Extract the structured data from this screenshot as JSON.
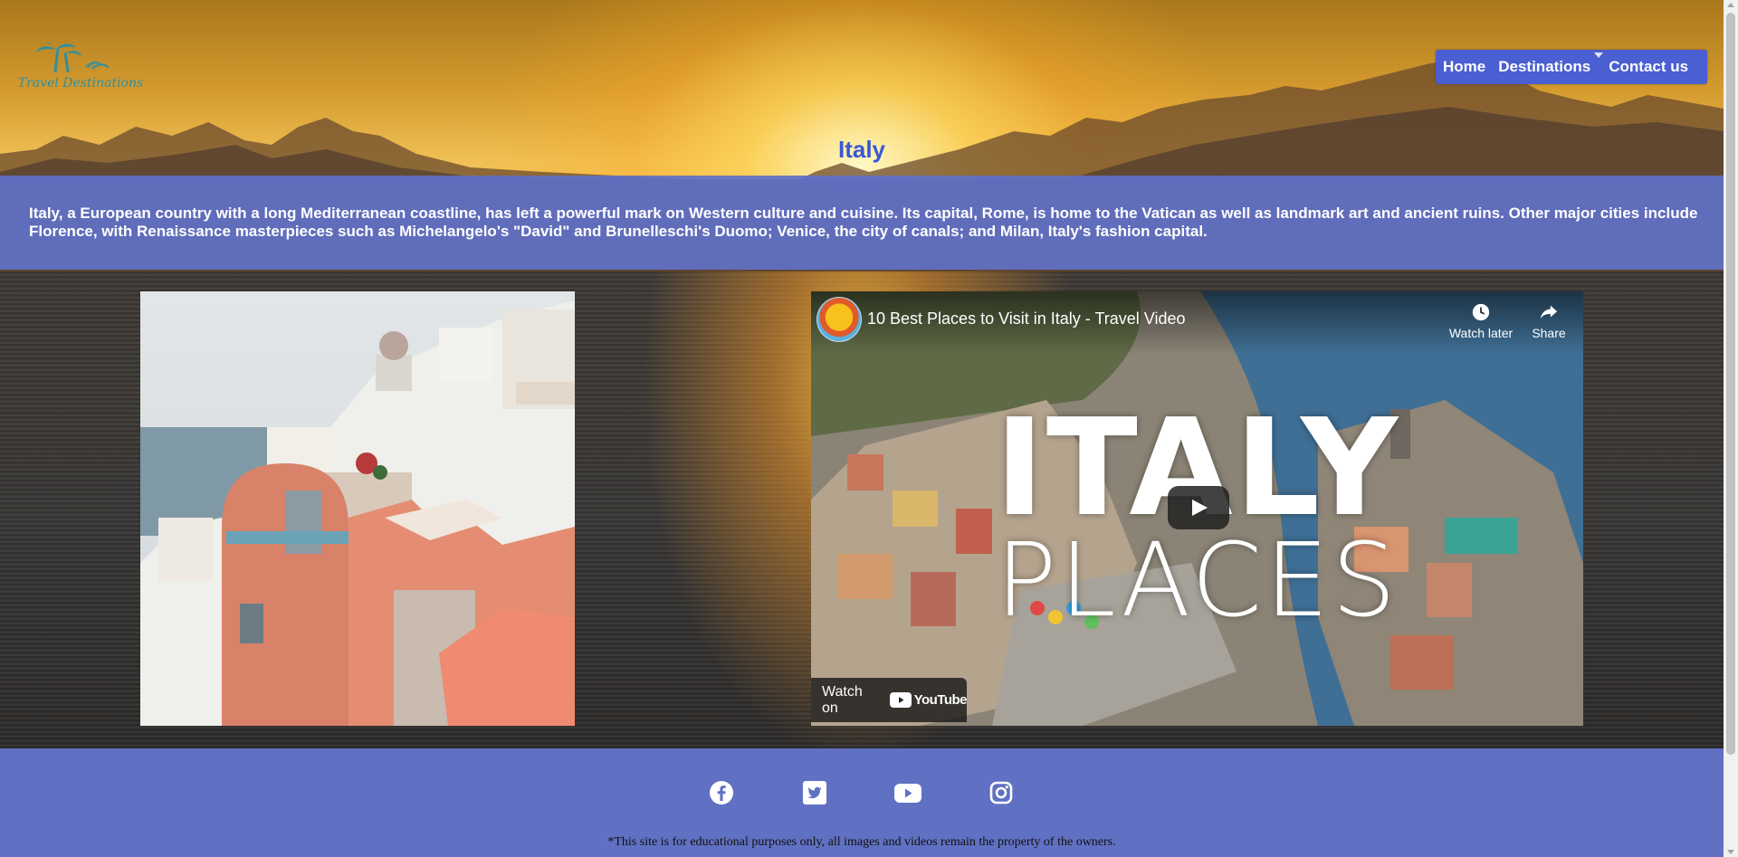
{
  "brand": {
    "logo_text": "Travel Destinations"
  },
  "nav": {
    "items": [
      {
        "label": "Home"
      },
      {
        "label": "Destinations"
      },
      {
        "label": "Contact us"
      }
    ]
  },
  "page": {
    "title": "Italy",
    "description": "Italy, a European country with a long Mediterranean coastline, has left a powerful mark on Western culture and cuisine. Its capital, Rome, is home to the Vatican as well as landmark art and ancient ruins. Other major cities include Florence, with Renaissance masterpieces such as Michelangelo's \"David\" and Brunelleschi's Duomo; Venice, the city of canals; and Milan, Italy's fashion capital."
  },
  "video": {
    "title": "10 Best Places to Visit in Italy - Travel Video",
    "watch_later": "Watch later",
    "share": "Share",
    "overlay_line1": "ITALY",
    "overlay_line2": "PLACES",
    "watch_on": "Watch on",
    "youtube_word": "YouTube"
  },
  "footer": {
    "social": [
      "facebook",
      "twitter",
      "youtube",
      "instagram"
    ],
    "disclaimer": "*This site is for educational purposes only, all images and videos remain the property of the owners."
  },
  "colors": {
    "nav_bg": "#4a5fd2",
    "title": "#3a56d6",
    "band_bg": "#6070c6",
    "footer_bg": "#6070c2"
  }
}
